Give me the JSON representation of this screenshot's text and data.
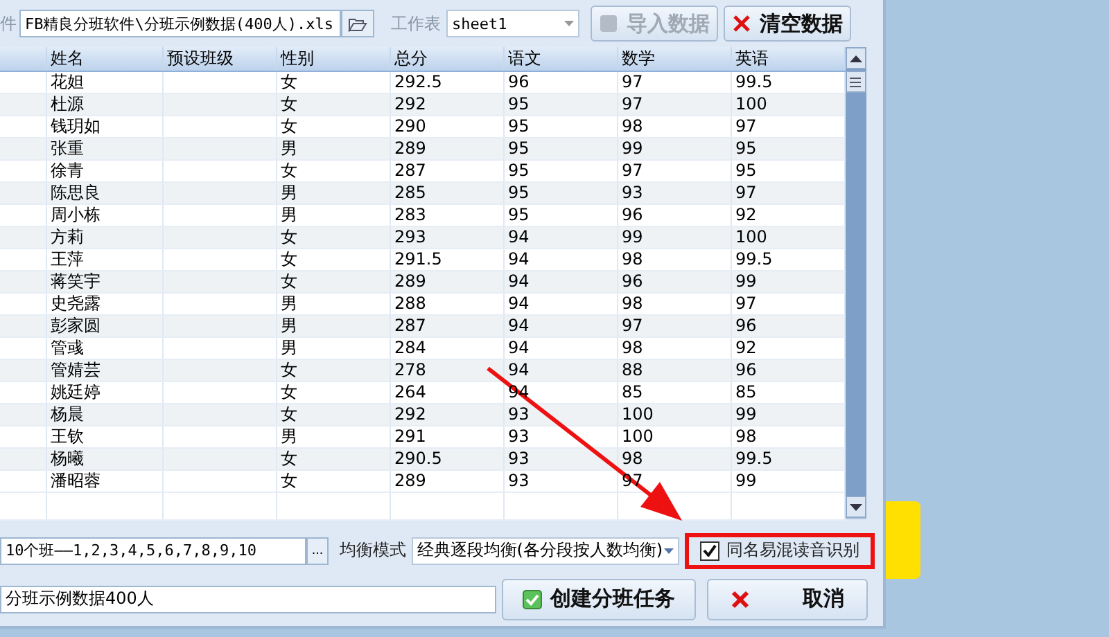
{
  "file_row": {
    "label": "件",
    "path": "FB精良分班软件\\分班示例数据(400人).xls",
    "sheet_label": "工作表",
    "sheet_value": "sheet1",
    "import_button": {
      "label": "导入数据",
      "disabled": true
    },
    "clear_button": {
      "label": "清空数据",
      "disabled": false
    }
  },
  "table": {
    "columns": [
      "姓名",
      "预设班级",
      "性别",
      "总分",
      "语文",
      "数学",
      "英语"
    ],
    "rows": [
      [
        "花妲",
        "",
        "女",
        "292.5",
        "96",
        "97",
        "99.5"
      ],
      [
        "杜源",
        "",
        "女",
        "292",
        "95",
        "97",
        "100"
      ],
      [
        "钱玥如",
        "",
        "女",
        "290",
        "95",
        "98",
        "97"
      ],
      [
        "张重",
        "",
        "男",
        "289",
        "95",
        "99",
        "95"
      ],
      [
        "徐青",
        "",
        "女",
        "287",
        "95",
        "97",
        "95"
      ],
      [
        "陈思良",
        "",
        "男",
        "285",
        "95",
        "93",
        "97"
      ],
      [
        "周小栋",
        "",
        "男",
        "283",
        "95",
        "96",
        "92"
      ],
      [
        "方莉",
        "",
        "女",
        "293",
        "94",
        "99",
        "100"
      ],
      [
        "王萍",
        "",
        "女",
        "291.5",
        "94",
        "98",
        "99.5"
      ],
      [
        "蒋笑宇",
        "",
        "女",
        "289",
        "94",
        "96",
        "99"
      ],
      [
        "史尧露",
        "",
        "男",
        "288",
        "94",
        "98",
        "97"
      ],
      [
        "彭家圆",
        "",
        "男",
        "287",
        "94",
        "97",
        "96"
      ],
      [
        "管彧",
        "",
        "男",
        "284",
        "94",
        "98",
        "92"
      ],
      [
        "管婧芸",
        "",
        "女",
        "278",
        "94",
        "88",
        "96"
      ],
      [
        "姚廷婷",
        "",
        "女",
        "264",
        "94",
        "85",
        "85"
      ],
      [
        "杨晨",
        "",
        "女",
        "292",
        "93",
        "100",
        "99"
      ],
      [
        "王钦",
        "",
        "男",
        "291",
        "93",
        "100",
        "98"
      ],
      [
        "杨曦",
        "",
        "女",
        "290.5",
        "93",
        "98",
        "99.5"
      ],
      [
        "潘昭蓉",
        "",
        "女",
        "289",
        "93",
        "97",
        "99"
      ]
    ]
  },
  "options_row": {
    "classes_value": "10个班——1,2,3,4,5,6,7,8,9,10",
    "more_button": "...",
    "mode_label": "均衡模式",
    "mode_value": "经典逐段均衡(各分段按人数均衡)",
    "homophone_check": {
      "label": "同名易混读音识别",
      "checked": true,
      "highlighted": true
    }
  },
  "task_row": {
    "name_value": "分班示例数据400人",
    "create_button": "创建分班任务",
    "cancel_button": "取消"
  },
  "annotation": {
    "arrow": true
  }
}
